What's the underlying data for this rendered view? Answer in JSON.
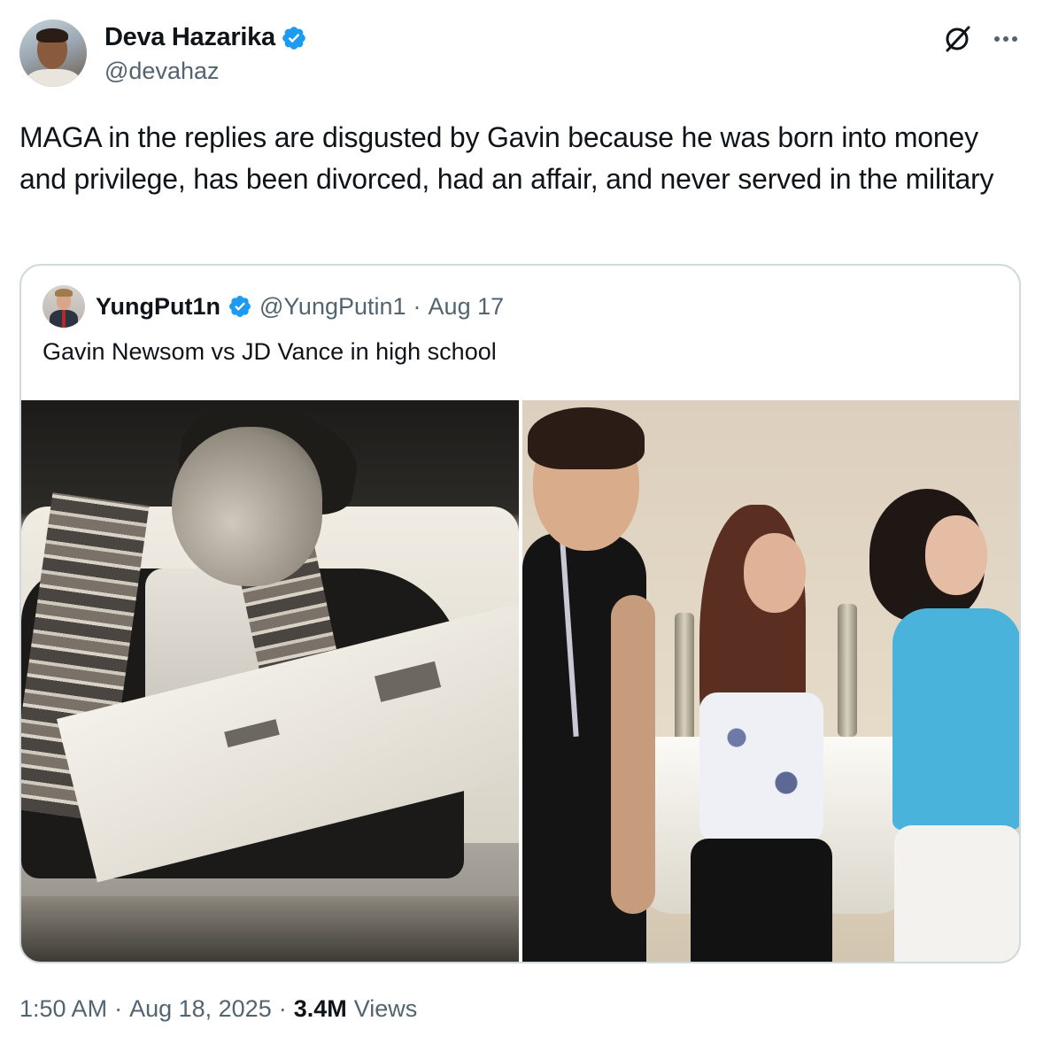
{
  "tweet": {
    "author": {
      "name": "Deva Hazarika",
      "handle": "@devahaz",
      "verified": true
    },
    "text": "MAGA in the replies are disgusted by Gavin because he was born into money and privilege, has been divorced, had an affair, and never served in the military",
    "timestamp": "1:50 AM",
    "separator": "·",
    "date": "Aug 18, 2025",
    "views_count": "3.4M",
    "views_label": "Views"
  },
  "quote": {
    "author": {
      "name": "YungPut1n",
      "handle": "@YungPutin1",
      "verified": true
    },
    "separator": "·",
    "date": "Aug 17",
    "text": "Gavin Newsom vs JD Vance in high school"
  },
  "icons": {
    "verified": "verified-badge-icon",
    "grok": "grok-icon",
    "more": "more-options-icon"
  },
  "colors": {
    "text_primary": "#0f1419",
    "text_secondary": "#536471",
    "verified_blue": "#1d9bf0",
    "border": "#cfd9de"
  }
}
